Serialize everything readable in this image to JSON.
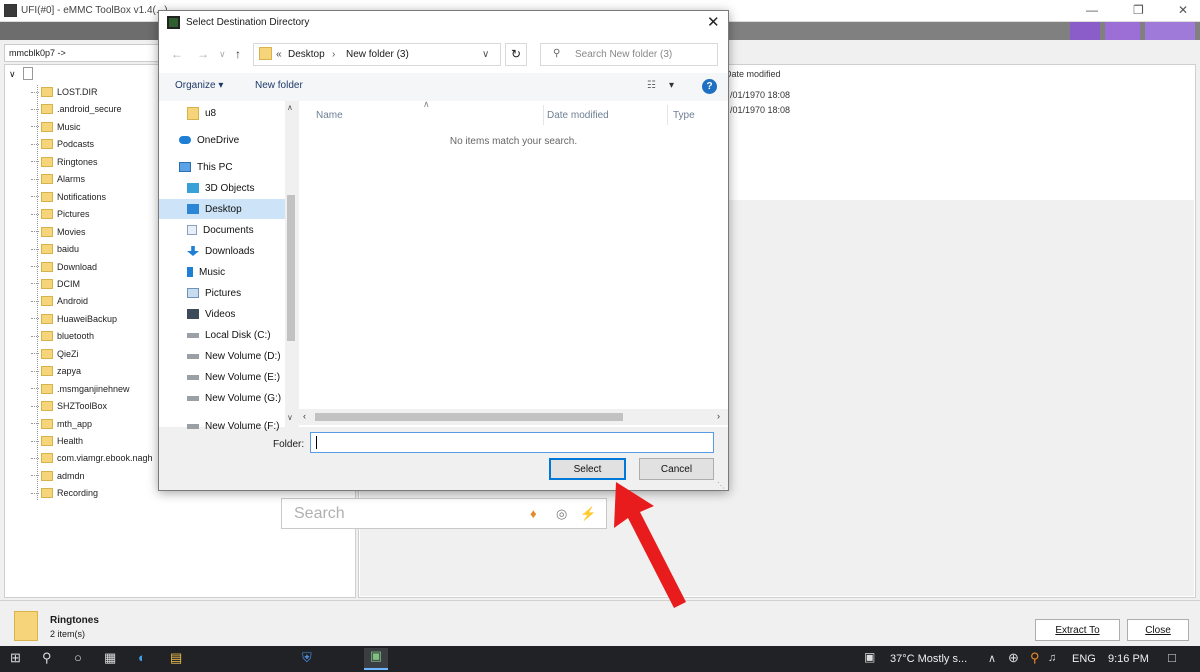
{
  "app": {
    "title": "UFI(#0] - eMMC ToolBox v1.4(...)",
    "path": "mmcblk0p7 ->",
    "tree": [
      "LOST.DIR",
      ".android_secure",
      "Music",
      "Podcasts",
      "Ringtones",
      "Alarms",
      "Notifications",
      "Pictures",
      "Movies",
      "baidu",
      "Download",
      "DCIM",
      "Android",
      "HuaweiBackup",
      "bluetooth",
      "QieZi",
      "zapya",
      ".msmganjinehnew",
      "SHZToolBox",
      "mth_app",
      "Health",
      "com.viamgr.ebook.nagh",
      "admdn",
      "Recording"
    ],
    "right_header": "Date modified",
    "right_rows": [
      "/01/1970 18:08",
      "/01/1970 18:08"
    ],
    "search_placeholder": "Search",
    "selected": {
      "name": "Ringtones",
      "count": "2 item(s)"
    },
    "extract_label": "Extract To",
    "close_label": "Close"
  },
  "dialog": {
    "title": "Select Destination Directory",
    "breadcrumb": [
      "Desktop",
      "New folder (3)"
    ],
    "breadcrumb_prefix": "«",
    "search_placeholder": "Search New folder (3)",
    "organize_label": "Organize",
    "new_folder_label": "New folder",
    "nav_items": [
      {
        "label": "u8",
        "icon": "folder-icon"
      },
      {
        "label": "OneDrive",
        "icon": "cloud-icon"
      },
      {
        "label": "This PC",
        "icon": "computer-icon"
      },
      {
        "label": "3D Objects",
        "icon": "cube-icon"
      },
      {
        "label": "Desktop",
        "icon": "desktop-icon",
        "selected": true
      },
      {
        "label": "Documents",
        "icon": "document-icon"
      },
      {
        "label": "Downloads",
        "icon": "download-arrow-icon"
      },
      {
        "label": "Music",
        "icon": "music-note-icon"
      },
      {
        "label": "Pictures",
        "icon": "picture-icon"
      },
      {
        "label": "Videos",
        "icon": "video-icon"
      },
      {
        "label": "Local Disk (C:)",
        "icon": "drive-icon"
      },
      {
        "label": "New Volume (D:)",
        "icon": "drive-icon"
      },
      {
        "label": "New Volume (E:)",
        "icon": "drive-icon"
      },
      {
        "label": "New Volume (G:)",
        "icon": "drive-icon"
      },
      {
        "label": "New Volume (F:)",
        "icon": "drive-icon"
      }
    ],
    "columns": [
      "Name",
      "Date modified",
      "Type"
    ],
    "empty_message": "No items match your search.",
    "folder_label": "Folder:",
    "folder_value": "",
    "select_label": "Select",
    "cancel_label": "Cancel"
  },
  "taskbar": {
    "weather": "37°C  Mostly s...",
    "language": "ENG",
    "time": "9:16 PM"
  },
  "colors": {
    "accent": "#0078d7",
    "arrow": "#e81c1c",
    "selection": "#cde3f7"
  }
}
